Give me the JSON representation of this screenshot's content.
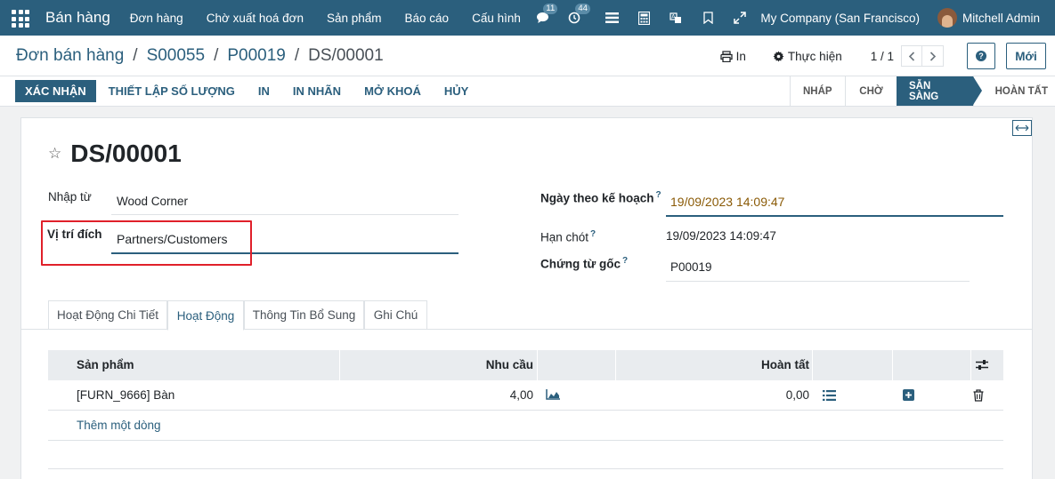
{
  "navbar": {
    "app_name": "Bán hàng",
    "menu": [
      "Đơn hàng",
      "Chờ xuất hoá đơn",
      "Sản phẩm",
      "Báo cáo",
      "Cấu hình"
    ],
    "messages_badge": "11",
    "activities_badge": "44",
    "company": "My Company (San Francisco)",
    "user": "Mitchell Admin"
  },
  "breadcrumb": [
    "Đơn bán hàng",
    "S00055",
    "P00019",
    "DS/00001"
  ],
  "control_panel": {
    "print_label": "In",
    "action_label": "Thực hiện",
    "pager": "1 / 1",
    "help_label": "?",
    "new_label": "Mới"
  },
  "statusbar": {
    "buttons": [
      "XÁC NHẬN",
      "THIẾT LẬP SỐ LƯỢNG",
      "IN",
      "IN NHÃN",
      "MỞ KHOÁ",
      "HỦY"
    ],
    "stages": [
      "NHÁP",
      "CHỜ",
      "SẴN SÀNG",
      "HOÀN TẤT"
    ],
    "current_stage": "SẴN SÀNG"
  },
  "form": {
    "title": "DS/00001",
    "source_label": "Nhập từ",
    "source_value": "Wood Corner",
    "dest_label": "Vị trí đích",
    "dest_value": "Partners/Customers",
    "scheduled_label": "Ngày theo kế hoạch",
    "scheduled_value": "19/09/2023 14:09:47",
    "deadline_label": "Hạn chót",
    "deadline_value": "19/09/2023 14:09:47",
    "origin_label": "Chứng từ gốc",
    "origin_value": "P00019",
    "help_mark": "?"
  },
  "tabs": [
    "Hoạt Động Chi Tiết",
    "Hoạt Động",
    "Thông Tin Bổ Sung",
    "Ghi Chú"
  ],
  "active_tab": "Hoạt Động",
  "table": {
    "headers": [
      "Sản phẩm",
      "Nhu cầu",
      "Hoàn tất"
    ],
    "rows": [
      {
        "product": "[FURN_9666] Bàn",
        "demand": "4,00",
        "done": "0,00"
      }
    ],
    "add_line": "Thêm một dòng"
  },
  "colors": {
    "brand": "#2b5f7d",
    "highlight": "#e0202a",
    "date": "#8a5a06"
  }
}
